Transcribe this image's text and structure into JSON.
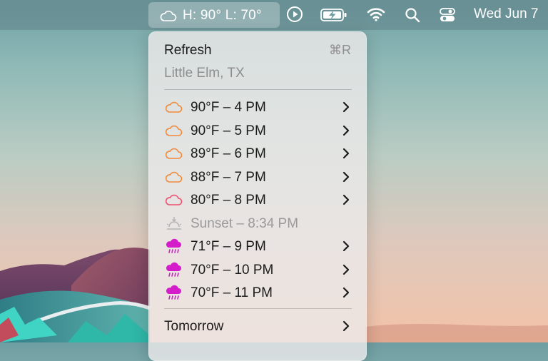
{
  "menubar": {
    "weather_label": "H: 90° L: 70°",
    "weather_icon": "cloud-icon",
    "icons": [
      "play-circle-icon",
      "battery-charging-icon",
      "wifi-icon",
      "search-icon",
      "control-center-icon"
    ],
    "date": "Wed Jun 7"
  },
  "menu": {
    "refresh_label": "Refresh",
    "refresh_shortcut": "⌘R",
    "location": "Little Elm, TX",
    "hours": [
      {
        "label": "90°F – 4 PM",
        "icon": "cloud-icon",
        "color": "#f08a3c"
      },
      {
        "label": "90°F – 5 PM",
        "icon": "cloud-icon",
        "color": "#f08a3c"
      },
      {
        "label": "89°F – 6 PM",
        "icon": "cloud-icon",
        "color": "#f08a3c"
      },
      {
        "label": "88°F – 7 PM",
        "icon": "cloud-icon",
        "color": "#f08a3c"
      },
      {
        "label": "80°F – 8 PM",
        "icon": "cloud-icon",
        "color": "#ef4f6e"
      },
      {
        "label": "Sunset – 8:34 PM",
        "icon": "sunset-icon",
        "color": "#b5b5b5"
      },
      {
        "label": "71°F – 9 PM",
        "icon": "rain-cloud-icon",
        "color": "#d41ccb"
      },
      {
        "label": "70°F – 10 PM",
        "icon": "rain-cloud-icon",
        "color": "#d41ccb"
      },
      {
        "label": "70°F – 11 PM",
        "icon": "rain-cloud-icon",
        "color": "#d41ccb"
      }
    ],
    "tomorrow_label": "Tomorrow"
  }
}
